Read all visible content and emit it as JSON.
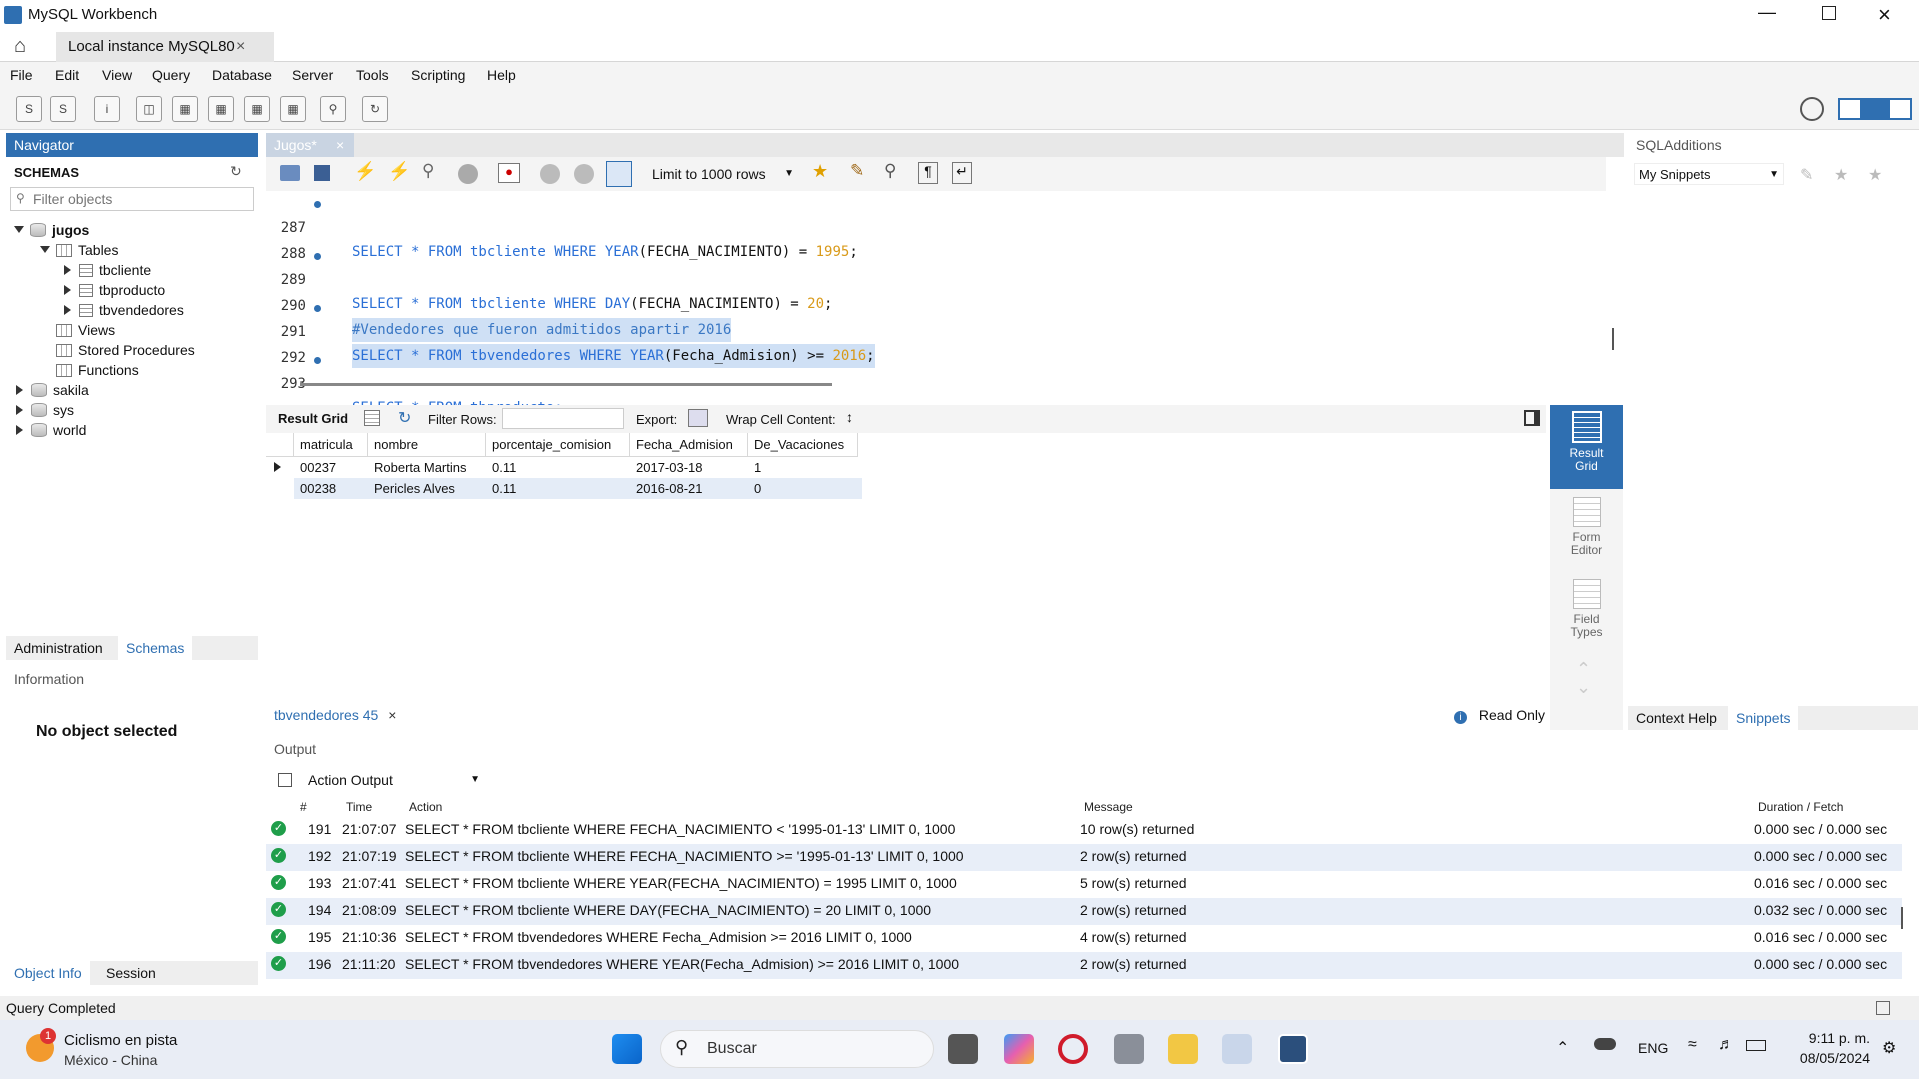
{
  "window": {
    "title": "MySQL Workbench"
  },
  "tabs": {
    "home_icon": "home-icon",
    "connection_tab": "Local instance MySQL80",
    "close": "×"
  },
  "menu": [
    "File",
    "Edit",
    "View",
    "Query",
    "Database",
    "Server",
    "Tools",
    "Scripting",
    "Help"
  ],
  "navigator": {
    "header": "Navigator",
    "schemas_title": "SCHEMAS",
    "filter_placeholder": "Filter objects",
    "tree": {
      "db_jugos": "jugos",
      "tables": "Tables",
      "table1": "tbcliente",
      "table2": "tbproducto",
      "table3": "tbvendedores",
      "views": "Views",
      "stored_procedures": "Stored Procedures",
      "functions": "Functions",
      "db_sakila": "sakila",
      "db_sys": "sys",
      "db_world": "world"
    },
    "tab_administration": "Administration",
    "tab_schemas": "Schemas",
    "information": "Information",
    "no_object": "No object selected",
    "tab_object_info": "Object Info",
    "tab_session": "Session"
  },
  "editor": {
    "tab_label": "Jugos*",
    "limit_label": "Limit to 1000 rows",
    "lines": [
      {
        "n": "287",
        "dot": true
      },
      {
        "n": "288",
        "dot": false
      },
      {
        "n": "289",
        "dot": true
      },
      {
        "n": "290",
        "dot": false
      },
      {
        "n": "291",
        "dot": true
      },
      {
        "n": "292",
        "dot": false
      },
      {
        "n": "293",
        "dot": true
      }
    ],
    "code": {
      "l287_a": "SELECT * FROM tbcliente ",
      "l287_b": "WHERE YEAR",
      "l287_c": "(FECHA_NACIMIENTO) = ",
      "l287_d": "1995",
      "l287_e": ";",
      "l289_a": "SELECT * FROM tbcliente ",
      "l289_b": "WHERE DAY",
      "l289_c": "(FECHA_NACIMIENTO) = ",
      "l289_d": "20",
      "l289_e": ";",
      "l290": "#Vendedores que fueron admitidos apartir 2016",
      "l291_a": "SELECT * FROM tbvendedores ",
      "l291_b": "WHERE YEAR",
      "l291_c": "(Fecha_Admision) >= ",
      "l291_d": "2016",
      "l291_e": ";",
      "l293": "SELECT * FROM tbproducto;"
    }
  },
  "resultbar": {
    "result_grid": "Result Grid",
    "filter_rows": "Filter Rows:",
    "export": "Export:",
    "wrap": "Wrap Cell Content:"
  },
  "grid": {
    "columns": [
      "matricula",
      "nombre",
      "porcentaje_comision",
      "Fecha_Admision",
      "De_Vacaciones"
    ],
    "rows": [
      [
        "00237",
        "Roberta Martins",
        "0.11",
        "2017-03-18",
        "1"
      ],
      [
        "00238",
        "Pericles Alves",
        "0.11",
        "2016-08-21",
        "0"
      ]
    ]
  },
  "side_buttons": {
    "result_grid": "Result Grid",
    "form_editor": "Form Editor",
    "field_types": "Field Types"
  },
  "result_tab": {
    "label": "tbvendedores 45",
    "read_only": "Read Only"
  },
  "sql_additions": {
    "header": "SQLAdditions",
    "snippets_select": "My Snippets",
    "tab_context_help": "Context Help",
    "tab_snippets": "Snippets"
  },
  "output": {
    "header": "Output",
    "select": "Action Output",
    "columns": {
      "num": "#",
      "time": "Time",
      "action": "Action",
      "message": "Message",
      "duration": "Duration / Fetch"
    },
    "rows": [
      {
        "n": "191",
        "time": "21:07:07",
        "action": "SELECT * FROM tbcliente WHERE FECHA_NACIMIENTO < '1995-01-13' LIMIT 0, 1000",
        "message": "10 row(s) returned",
        "duration": "0.000 sec / 0.000 sec"
      },
      {
        "n": "192",
        "time": "21:07:19",
        "action": "SELECT * FROM tbcliente WHERE FECHA_NACIMIENTO >= '1995-01-13' LIMIT 0, 1000",
        "message": "2 row(s) returned",
        "duration": "0.000 sec / 0.000 sec"
      },
      {
        "n": "193",
        "time": "21:07:41",
        "action": "SELECT * FROM tbcliente WHERE YEAR(FECHA_NACIMIENTO) = 1995 LIMIT 0, 1000",
        "message": "5 row(s) returned",
        "duration": "0.016 sec / 0.000 sec"
      },
      {
        "n": "194",
        "time": "21:08:09",
        "action": "SELECT * FROM tbcliente WHERE DAY(FECHA_NACIMIENTO) = 20 LIMIT 0, 1000",
        "message": "2 row(s) returned",
        "duration": "0.032 sec / 0.000 sec"
      },
      {
        "n": "195",
        "time": "21:10:36",
        "action": "SELECT * FROM tbvendedores WHERE Fecha_Admision >= 2016 LIMIT 0, 1000",
        "message": "4 row(s) returned",
        "duration": "0.016 sec / 0.000 sec"
      },
      {
        "n": "196",
        "time": "21:11:20",
        "action": "SELECT * FROM tbvendedores WHERE YEAR(Fecha_Admision) >= 2016 LIMIT 0, 1000",
        "message": "2 row(s) returned",
        "duration": "0.000 sec / 0.000 sec"
      }
    ]
  },
  "status": {
    "text": "Query Completed"
  },
  "taskbar": {
    "news_title": "Ciclismo en pista",
    "news_sub": "México - China",
    "news_badge": "1",
    "search": "Buscar",
    "lang": "ENG",
    "time": "9:11 p. m.",
    "date": "08/05/2024"
  },
  "colors": {
    "accent": "#2f6fb1",
    "keyword": "#2a6fd6",
    "number": "#d99a1a",
    "ok": "#1f9e4a"
  }
}
